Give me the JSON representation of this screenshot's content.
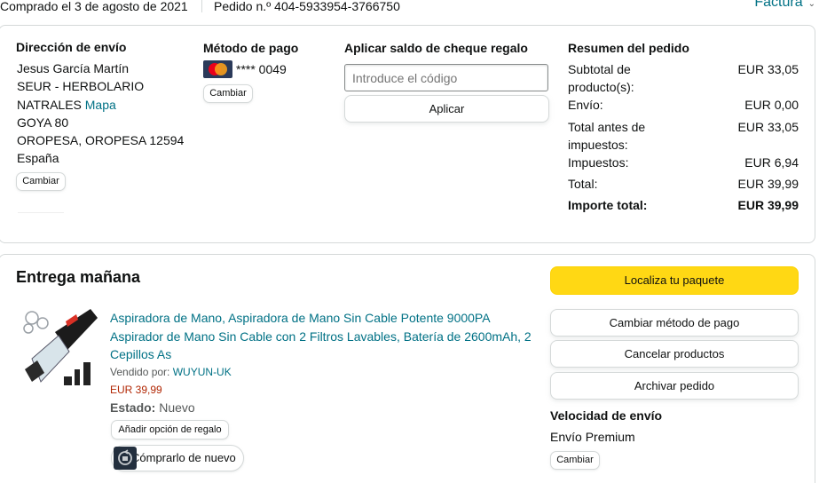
{
  "header": {
    "purchase_date": "Comprado el 3 de agosto de 2021",
    "order_number": "Pedido n.º 404-5933954-3766750",
    "invoice_label": "Factura"
  },
  "shipping": {
    "title": "Dirección de envío",
    "lines": [
      "Jesus García Martín",
      "SEUR - HERBOLARIO",
      "NATRALES",
      "GOYA 80",
      "OROPESA, OROPESA 12594",
      "España"
    ],
    "map_link": "Mapa",
    "change_label": "Cambiar"
  },
  "payment": {
    "title": "Método de pago",
    "card_digits": "**** 0049",
    "card_brand_icon": "mastercard-icon",
    "change_label": "Cambiar"
  },
  "gift": {
    "title": "Aplicar saldo de cheque regalo",
    "placeholder": "Introduce el código",
    "apply_label": "Aplicar"
  },
  "summary": {
    "title": "Resumen del pedido",
    "rows": [
      {
        "label": "Subtotal de producto(s):",
        "value": "EUR 33,05"
      },
      {
        "label": "Envío:",
        "value": "EUR 0,00"
      },
      {
        "label": "Total antes de impuestos:",
        "value": "EUR 33,05"
      },
      {
        "label": "Impuestos:",
        "value": "EUR 6,94"
      },
      {
        "label": "Total:",
        "value": "EUR 39,99"
      },
      {
        "label": "Importe total:",
        "value": "EUR 39,99"
      }
    ]
  },
  "delivery": {
    "title": "Entrega mañana",
    "product_title": "Aspiradora de Mano, Aspiradora de Mano Sin Cable Potente 9000PA Aspirador de Mano Sin Cable con 2 Filtros Lavables, Batería de 2600mAh, 2 Cepillos As",
    "sold_by_label": "Vendido por:",
    "sold_by_value": "WUYUN-UK",
    "price": "EUR 39,99",
    "condition_label": "Estado:",
    "condition_value": "Nuevo",
    "gift_option_label": "Añadir opción de regalo",
    "buy_again_label": "Cómprarlo de nuevo"
  },
  "actions": {
    "locate": "Localiza tu paquete",
    "change_payment": "Cambiar método de pago",
    "cancel": "Cancelar productos",
    "archive": "Archivar pedido"
  },
  "shipping_speed": {
    "title": "Velocidad de envío",
    "value": "Envío Premium",
    "change_label": "Cambiar"
  },
  "colors": {
    "link": "#007185",
    "primary_button": "#ffd814",
    "price": "#b12704",
    "border": "#d5d9d9"
  }
}
